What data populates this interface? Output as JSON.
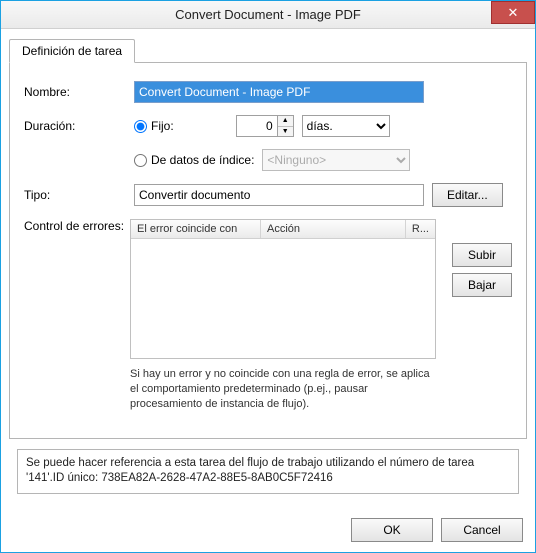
{
  "window": {
    "title": "Convert Document - Image PDF"
  },
  "tabs": {
    "definition": "Definición de tarea"
  },
  "labels": {
    "nombre": "Nombre:",
    "duracion": "Duración:",
    "tipo": "Tipo:",
    "errores": "Control de errores:"
  },
  "fields": {
    "nombre_value": "Convert Document - Image PDF",
    "fijo_label": "Fijo:",
    "fijo_value": "0",
    "fijo_unit": "días.",
    "indice_label": "De datos de índice:",
    "indice_value": "<Ninguno>",
    "tipo_value": "Convertir documento"
  },
  "buttons": {
    "editar": "Editar...",
    "subir": "Subir",
    "bajar": "Bajar",
    "ok": "OK",
    "cancel": "Cancel"
  },
  "err_table": {
    "col_match": "El error coincide con",
    "col_action": "Acción",
    "col_r": "R..."
  },
  "note_text": "Si hay un error y no coincide con una regla de error, se aplica el comportamiento predeterminado (p.ej., pausar procesamiento de instancia de flujo).",
  "ref_text": "Se puede hacer referencia a esta tarea del flujo de trabajo utilizando el número de tarea '141'.ID único: 738EA82A-2628-47A2-88E5-8AB0C5F72416"
}
